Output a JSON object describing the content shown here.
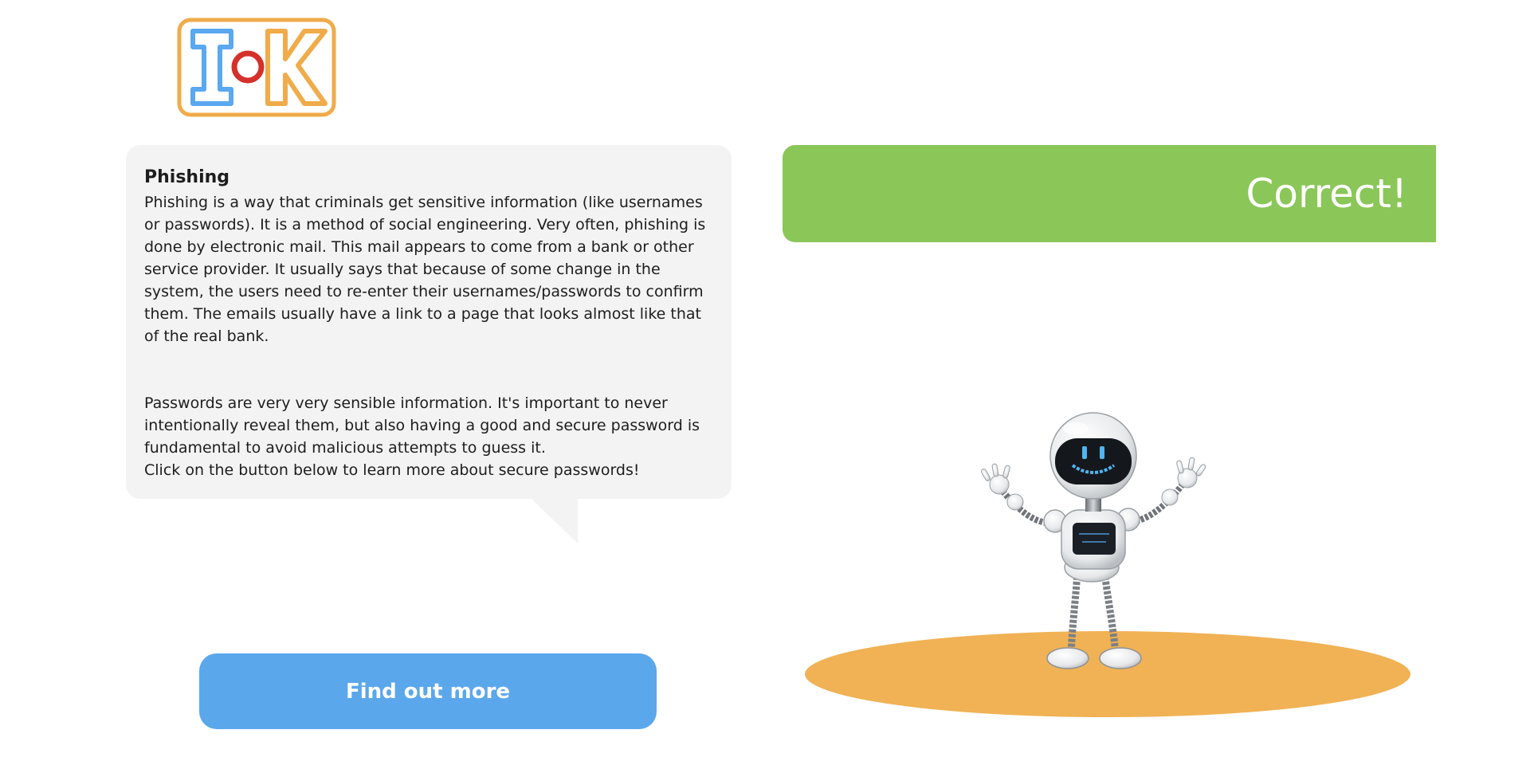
{
  "logo": {
    "text": "IoK",
    "colors": {
      "frame": "#f0ab4a",
      "i": "#5aa8ef",
      "o": "#d6302b",
      "k": "#f0ab4a"
    }
  },
  "info": {
    "title": "Phishing",
    "paragraph1": "Phishing is a way that criminals get sensitive information (like usernames or passwords). It is a method of social engineering. Very often, phishing is done by electronic mail. This mail appears to come from a bank or other service provider. It usually says that because of some change in the system, the users need to re-enter their usernames/passwords to confirm them. The emails usually have a link to a page that looks almost like that of the real bank.",
    "paragraph2": "Passwords are very very sensible information. It's important to never intentionally reveal them, but also having a good and secure password is fundamental to avoid malicious attempts to guess it.",
    "paragraph3": "Click on the button below to learn more about secure passwords!"
  },
  "button": {
    "label": "Find out more"
  },
  "result": {
    "text": "Correct!",
    "color": "#8bc659"
  },
  "colors": {
    "bubble": "#f3f3f3",
    "button": "#5ba7ec",
    "stage": "#f0b254"
  },
  "icons": {
    "robot": "robot-icon"
  }
}
